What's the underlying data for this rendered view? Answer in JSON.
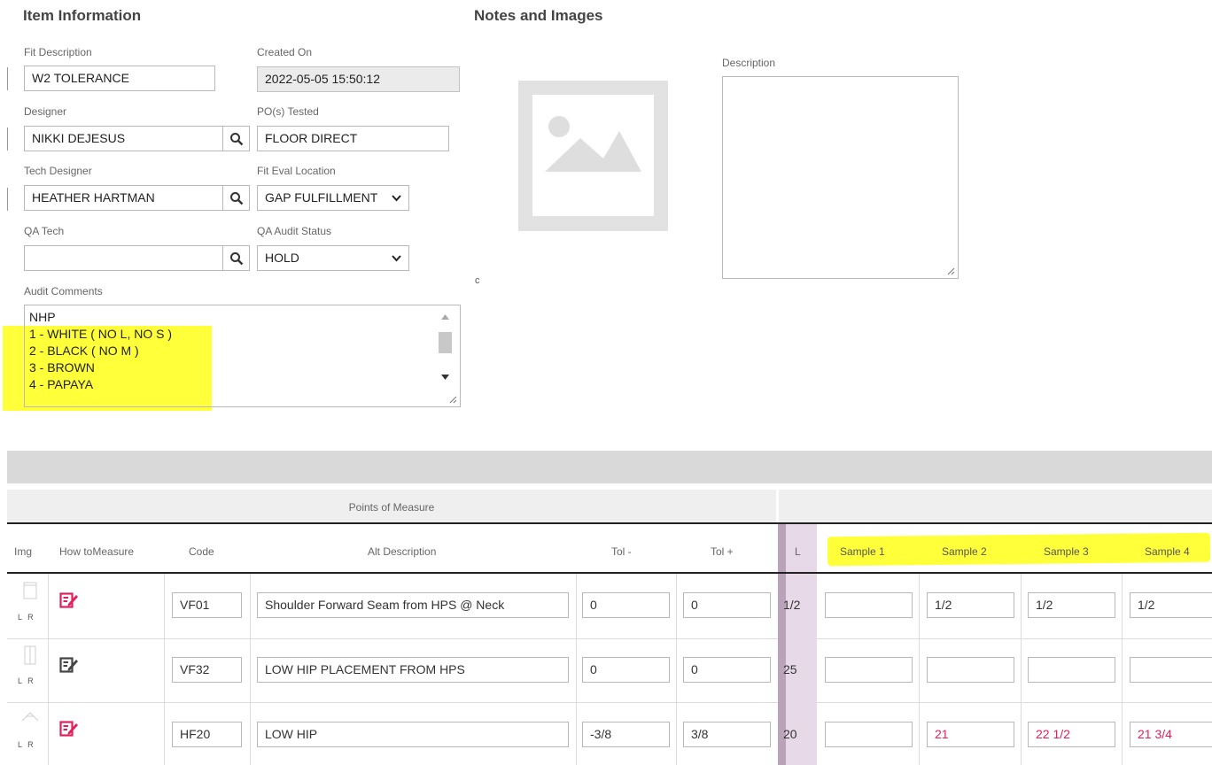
{
  "item_info": {
    "title": "Item Information",
    "fit_description": {
      "label": "Fit Description",
      "value": "W2 TOLERANCE"
    },
    "created_on": {
      "label": "Created On",
      "value": "2022-05-05 15:50:12"
    },
    "designer": {
      "label": "Designer",
      "value": "NIKKI DEJESUS"
    },
    "pos_tested": {
      "label": "PO(s) Tested",
      "value": "FLOOR DIRECT"
    },
    "tech_designer": {
      "label": "Tech Designer",
      "value": "HEATHER HARTMAN"
    },
    "fit_eval_location": {
      "label": "Fit Eval Location",
      "value": "GAP FULFILLMENT"
    },
    "qa_tech": {
      "label": "QA Tech",
      "value": ""
    },
    "qa_audit_status": {
      "label": "QA Audit Status",
      "value": "HOLD"
    },
    "audit_comments": {
      "label": "Audit Comments",
      "lines": [
        "NHP",
        "1 - WHITE ( NO L, NO S )",
        "2 - BLACK  ( NO M )",
        "3 - BROWN",
        "4 - PAPAYA"
      ]
    }
  },
  "notes": {
    "title": "Notes and Images",
    "description_label": "Description",
    "description_value": "",
    "stray_char": "c"
  },
  "table": {
    "group_header": "Points of Measure",
    "headers": {
      "img": "Img",
      "how": "How toMeasure",
      "code": "Code",
      "alt": "Alt Description",
      "tol_minus": "Tol -",
      "tol_plus": "Tol +",
      "size": "L",
      "s1": "Sample 1",
      "s2": "Sample 2",
      "s3": "Sample 3",
      "s4": "Sample 4"
    },
    "thumb_label": "L R",
    "rows": [
      {
        "code": "VF01",
        "alt": "Shoulder Forward Seam from HPS @ Neck",
        "tol_minus": "0",
        "tol_plus": "0",
        "size": "1/2",
        "s1": "",
        "s2": "1/2",
        "s3": "1/2",
        "s4": "1/2",
        "icon_color": "#e0205a"
      },
      {
        "code": "VF32",
        "alt": "LOW HIP PLACEMENT FROM HPS",
        "tol_minus": "0",
        "tol_plus": "0",
        "size": "25",
        "s1": "",
        "s2": "",
        "s3": "",
        "s4": "",
        "icon_color": "#444444"
      },
      {
        "code": "HF20",
        "alt": "LOW HIP",
        "tol_minus": "-3/8",
        "tol_plus": "3/8",
        "size": "20",
        "s1": "",
        "s2": "21",
        "s3": "22 1/2",
        "s4": "21 3/4",
        "icon_color": "#e0205a"
      }
    ]
  },
  "colors": {
    "highlight": "#ffff3a",
    "accent_red": "#e0205a",
    "size_column": "#e8d9e8"
  }
}
